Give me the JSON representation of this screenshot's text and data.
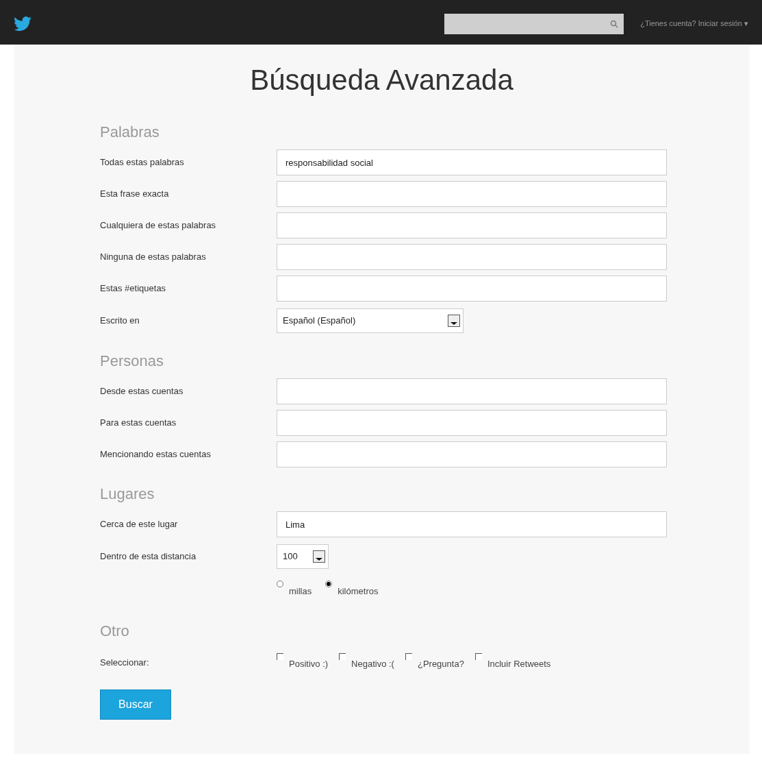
{
  "topbar": {
    "login": "¿Tienes cuenta? Iniciar sesión",
    "login_caret": "▾"
  },
  "title": "Búsqueda Avanzada",
  "sections": [
    {
      "heading": "Palabras",
      "rows": [
        {
          "kind": "text",
          "label": "Todas estas palabras",
          "value": "responsabilidad social"
        },
        {
          "kind": "text",
          "label": "Esta frase exacta"
        },
        {
          "kind": "text",
          "label": "Cualquiera de estas palabras"
        },
        {
          "kind": "text",
          "label": "Ninguna de estas palabras"
        },
        {
          "kind": "text",
          "label": "Estas #etiquetas"
        },
        {
          "kind": "select",
          "label": "Escrito en",
          "value": "Español (Español)"
        }
      ]
    },
    {
      "heading": "Personas",
      "rows": [
        {
          "kind": "text",
          "label": "Desde estas cuentas"
        },
        {
          "kind": "text",
          "label": "Para estas cuentas"
        },
        {
          "kind": "text",
          "label": "Mencionando estas cuentas"
        }
      ]
    },
    {
      "heading": "Lugares",
      "rows": [
        {
          "kind": "text",
          "label": "Cerca de este lugar",
          "value": "Lima"
        },
        {
          "kind": "select-small",
          "label": "Dentro de esta distancia",
          "value": "100"
        },
        {
          "kind": "radios",
          "options": [
            {
              "label": "millas",
              "selected": false
            },
            {
              "label": "kilómetros",
              "selected": true
            }
          ]
        }
      ]
    },
    {
      "heading": "Otro",
      "rows": [
        {
          "kind": "checkboxes",
          "label": "Seleccionar:",
          "options": [
            {
              "label": "Positivo :)",
              "checked": false
            },
            {
              "label": "Negativo :(",
              "checked": false
            },
            {
              "label": "¿Pregunta?",
              "checked": false
            },
            {
              "label": "Incluir Retweets",
              "checked": false
            }
          ]
        }
      ]
    }
  ],
  "submit": "Buscar"
}
